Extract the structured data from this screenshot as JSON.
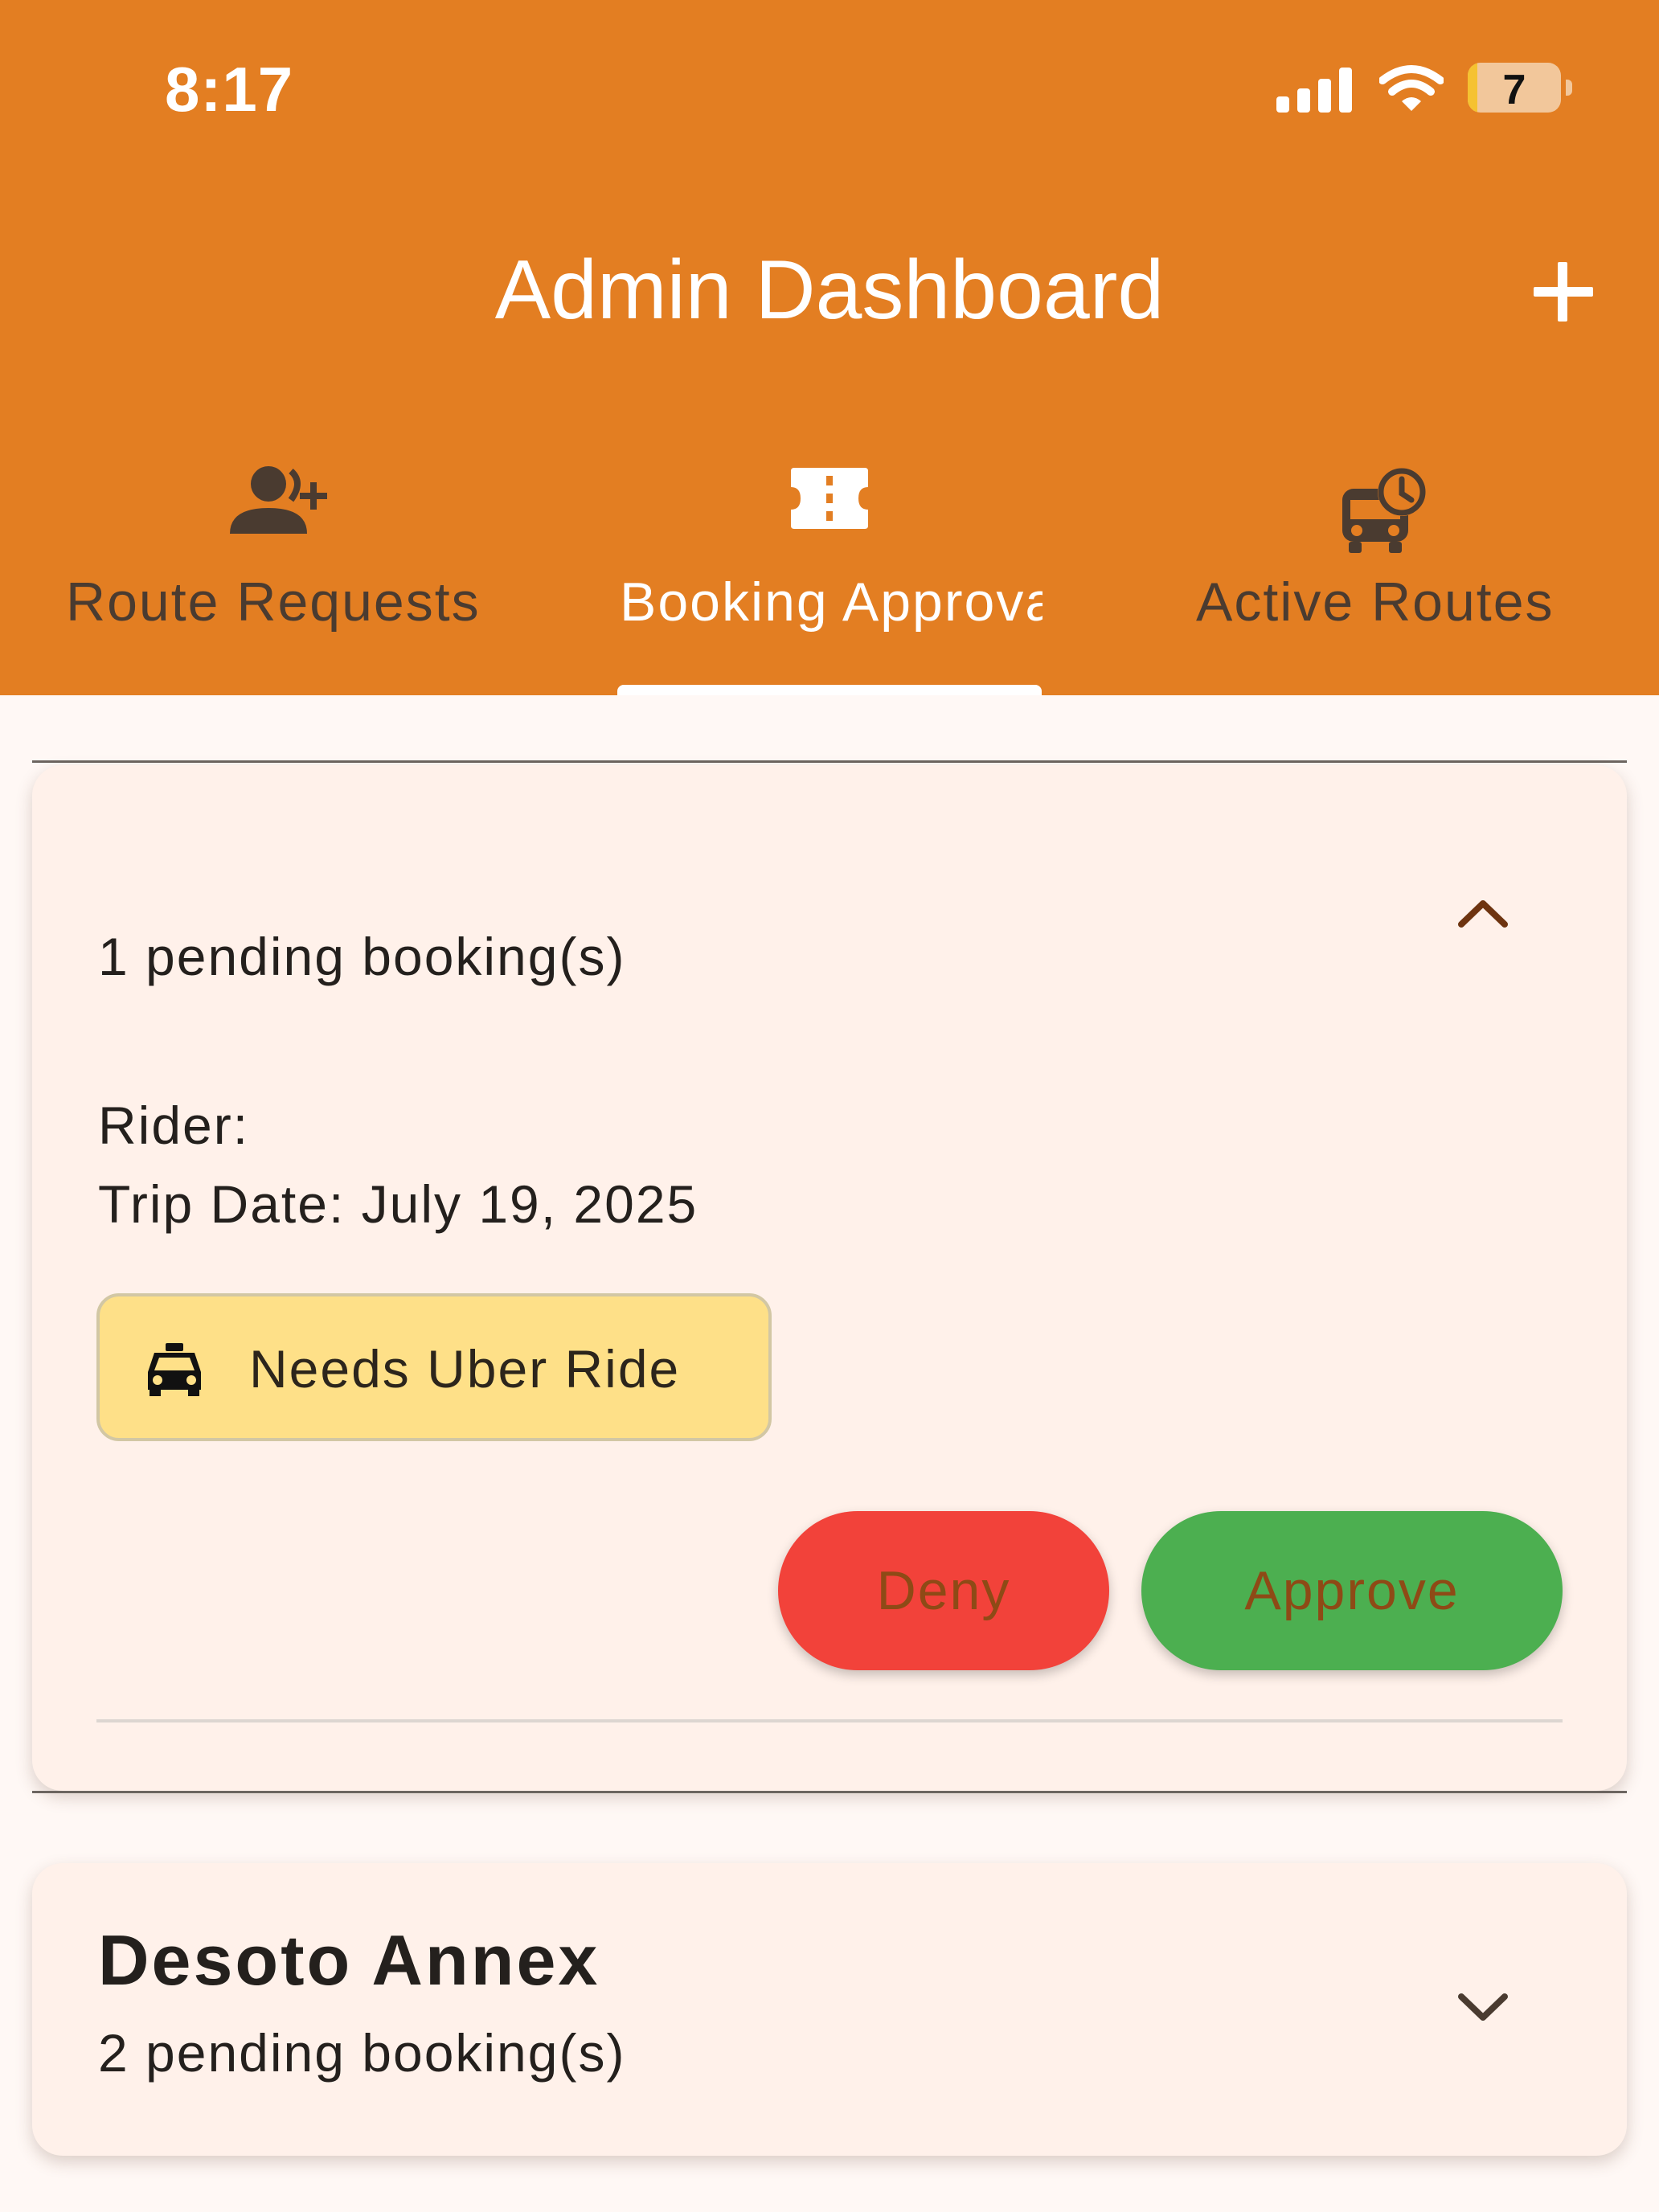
{
  "status_bar": {
    "time": "8:17",
    "battery": "7"
  },
  "app_bar": {
    "title": "Admin Dashboard",
    "add_icon": "plus-icon"
  },
  "tabs": [
    {
      "label": "Route Requests",
      "icon": "person-add-icon",
      "selected": false
    },
    {
      "label": "Booking Approvals",
      "icon": "ticket-icon",
      "selected": true
    },
    {
      "label": "Active Routes",
      "icon": "bus-clock-icon",
      "selected": false
    }
  ],
  "groups": [
    {
      "title": "",
      "pending": "1 pending booking(s)",
      "expanded": true,
      "bookings": [
        {
          "rider": "Rider:",
          "trip_date": "Trip Date: July 19, 2025",
          "uber_chip": "Needs Uber Ride",
          "deny_label": "Deny",
          "approve_label": "Approve"
        }
      ]
    },
    {
      "title": "Desoto Annex",
      "pending": "2 pending booking(s)",
      "expanded": false
    }
  ],
  "colors": {
    "header": "#E37E22",
    "background": "#FFF8F5",
    "card": "#FFF1EA",
    "deny": "#F2423A",
    "approve": "#4CAF50",
    "chip": "#FEE088",
    "tab_inactive": "#4A3B30"
  }
}
